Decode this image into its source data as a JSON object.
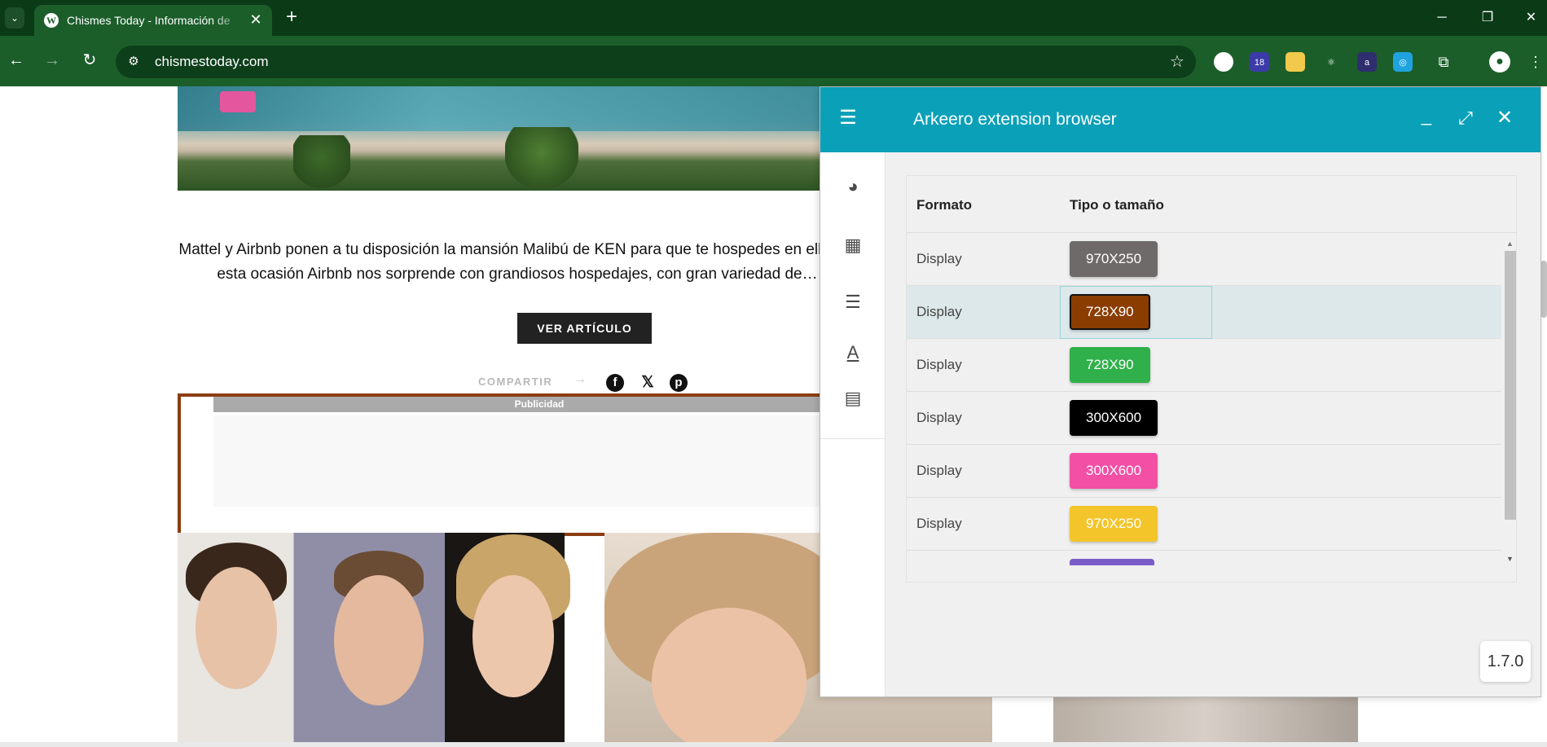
{
  "browser": {
    "tab_title": "Chismes Today - Información de",
    "url": "chismestoday.com",
    "tab_close_glyph": "✕",
    "new_tab_glyph": "+",
    "extensions": [
      {
        "name": "extension-1",
        "color": "#ffffff",
        "text": ""
      },
      {
        "name": "extension-notifications",
        "color": "#3b3ba8",
        "text": "18"
      },
      {
        "name": "extension-notes",
        "color": "#f2c94c",
        "text": ""
      },
      {
        "name": "extension-react",
        "color": "#1b5e2a",
        "text": "⚛"
      },
      {
        "name": "extension-a",
        "color": "#2e2e6e",
        "text": "a"
      },
      {
        "name": "extension-screenshot",
        "color": "#1fa3e0",
        "text": "◎"
      }
    ]
  },
  "article": {
    "excerpt": "Mattel y Airbnb ponen a tu disposición la mansión Malibú de KEN para que te hospedes en ella, en esta ocasión Airbnb nos sorprende con grandiosos hospedajes, con gran variedad de…",
    "read_button": "VER ARTÍCULO",
    "share_label": "COMPARTIR",
    "ad_label": "Publicidad"
  },
  "extension_panel": {
    "title": "Arkeero extension browser",
    "table": {
      "headers": [
        "Formato",
        "Tipo o tamaño"
      ],
      "rows": [
        {
          "format": "Display",
          "size": "970X250",
          "color": "#6e6a6a",
          "selected": false
        },
        {
          "format": "Display",
          "size": "728X90",
          "color": "#8b3d00",
          "selected": true
        },
        {
          "format": "Display",
          "size": "728X90",
          "color": "#2fb04a",
          "selected": false
        },
        {
          "format": "Display",
          "size": "300X600",
          "color": "#000000",
          "selected": false
        },
        {
          "format": "Display",
          "size": "300X600",
          "color": "#f24fa5",
          "selected": false
        },
        {
          "format": "Display",
          "size": "970X250",
          "color": "#f3c52b",
          "selected": false
        }
      ]
    },
    "version": "1.7.0"
  }
}
